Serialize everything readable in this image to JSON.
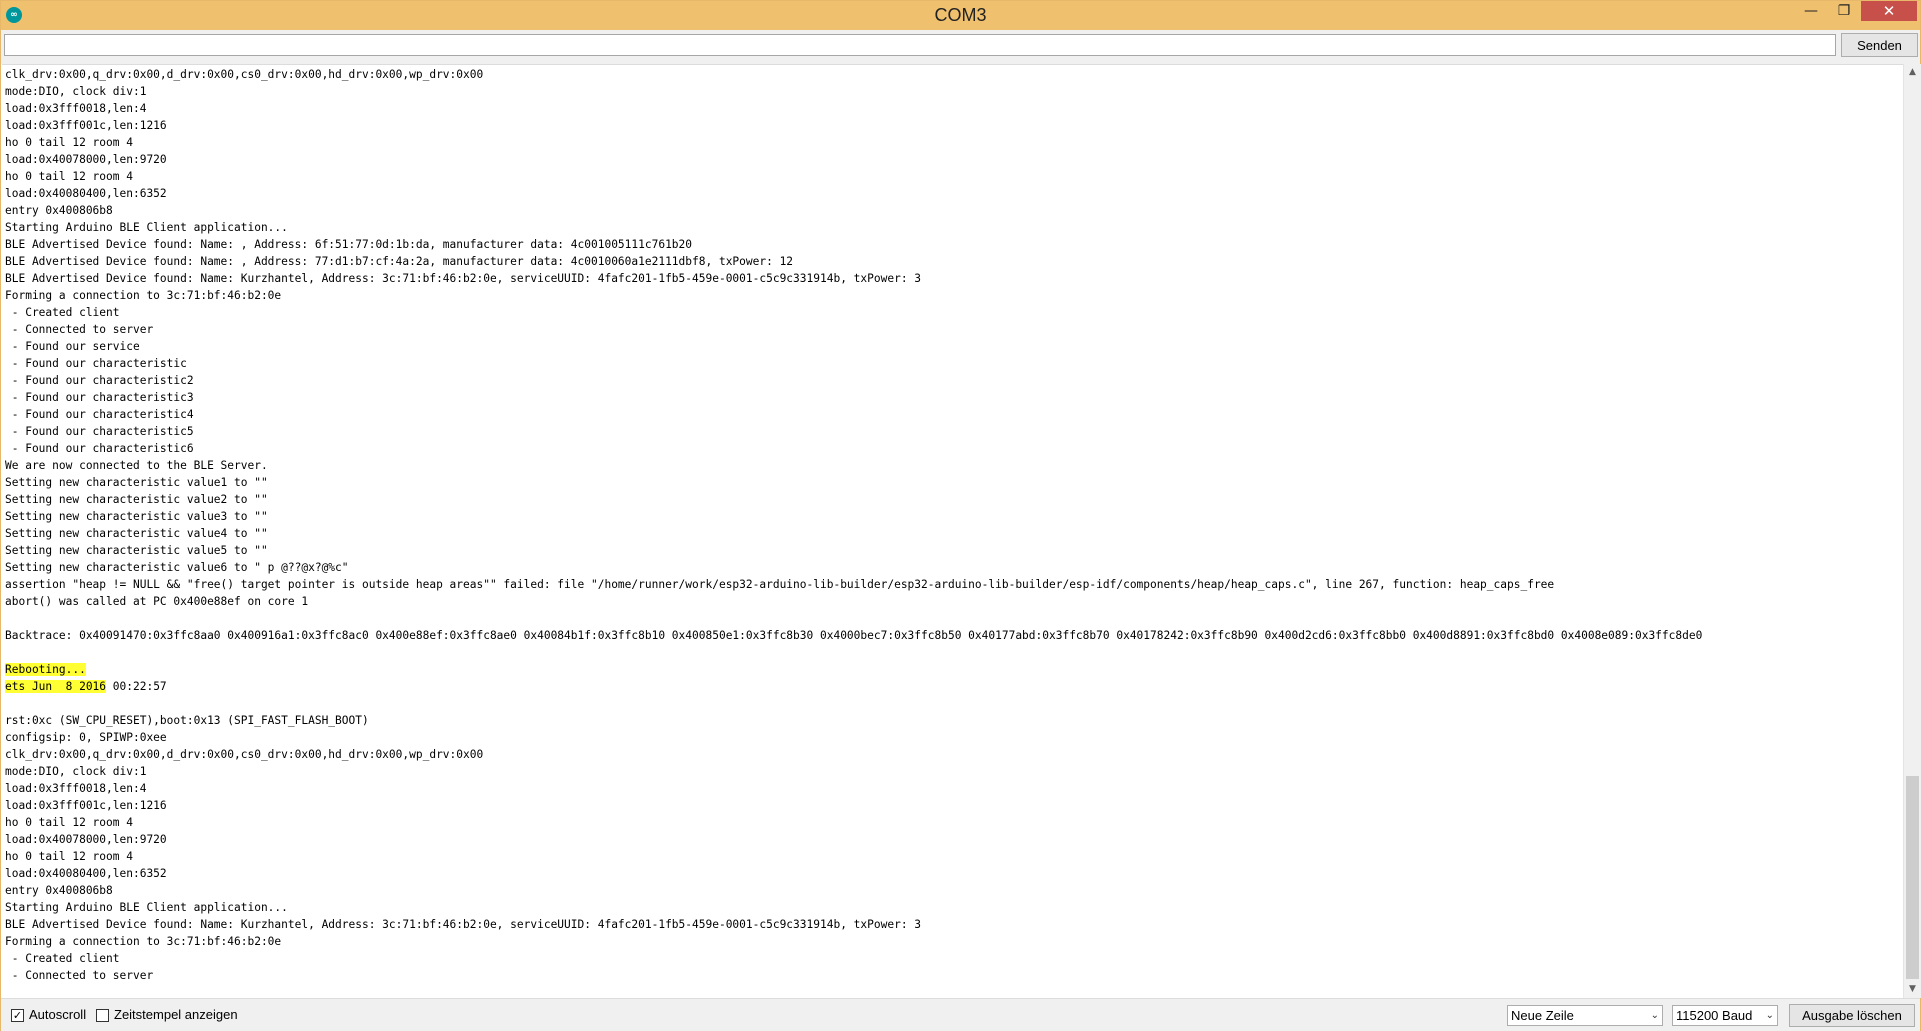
{
  "window": {
    "title": "COM3",
    "minimize_glyph": "—",
    "maximize_glyph": "❐",
    "close_glyph": "✕",
    "accent_color": "#efc06e",
    "close_color": "#c7504b"
  },
  "sendbar": {
    "input_value": "",
    "send_label": "Senden"
  },
  "output": {
    "lines": [
      {
        "text": "clk_drv:0x00,q_drv:0x00,d_drv:0x00,cs0_drv:0x00,hd_drv:0x00,wp_drv:0x00"
      },
      {
        "text": "mode:DIO, clock div:1"
      },
      {
        "text": "load:0x3fff0018,len:4"
      },
      {
        "text": "load:0x3fff001c,len:1216"
      },
      {
        "text": "ho 0 tail 12 room 4"
      },
      {
        "text": "load:0x40078000,len:9720"
      },
      {
        "text": "ho 0 tail 12 room 4"
      },
      {
        "text": "load:0x40080400,len:6352"
      },
      {
        "text": "entry 0x400806b8"
      },
      {
        "text": "Starting Arduino BLE Client application..."
      },
      {
        "text": "BLE Advertised Device found: Name: , Address: 6f:51:77:0d:1b:da, manufacturer data: 4c001005111c761b20"
      },
      {
        "text": "BLE Advertised Device found: Name: , Address: 77:d1:b7:cf:4a:2a, manufacturer data: 4c0010060a1e2111dbf8, txPower: 12"
      },
      {
        "text": "BLE Advertised Device found: Name: Kurzhantel, Address: 3c:71:bf:46:b2:0e, serviceUUID: 4fafc201-1fb5-459e-0001-c5c9c331914b, txPower: 3"
      },
      {
        "text": "Forming a connection to 3c:71:bf:46:b2:0e"
      },
      {
        "text": " - Created client"
      },
      {
        "text": " - Connected to server"
      },
      {
        "text": " - Found our service"
      },
      {
        "text": " - Found our characteristic"
      },
      {
        "text": " - Found our characteristic2"
      },
      {
        "text": " - Found our characteristic3"
      },
      {
        "text": " - Found our characteristic4"
      },
      {
        "text": " - Found our characteristic5"
      },
      {
        "text": " - Found our characteristic6"
      },
      {
        "text": "We are now connected to the BLE Server."
      },
      {
        "text": "Setting new characteristic value1 to \"\""
      },
      {
        "text": "Setting new characteristic value2 to \"\""
      },
      {
        "text": "Setting new characteristic value3 to \"\""
      },
      {
        "text": "Setting new characteristic value4 to \"\""
      },
      {
        "text": "Setting new characteristic value5 to \"\""
      },
      {
        "text": "Setting new characteristic value6 to \" p @??@x?@%c\""
      },
      {
        "text": "assertion \"heap != NULL && \"free() target pointer is outside heap areas\"\" failed: file \"/home/runner/work/esp32-arduino-lib-builder/esp32-arduino-lib-builder/esp-idf/components/heap/heap_caps.c\", line 267, function: heap_caps_free"
      },
      {
        "text": "abort() was called at PC 0x400e88ef on core 1"
      },
      {
        "text": ""
      },
      {
        "text": "Backtrace: 0x40091470:0x3ffc8aa0 0x400916a1:0x3ffc8ac0 0x400e88ef:0x3ffc8ae0 0x40084b1f:0x3ffc8b10 0x400850e1:0x3ffc8b30 0x4000bec7:0x3ffc8b50 0x40177abd:0x3ffc8b70 0x40178242:0x3ffc8b90 0x400d2cd6:0x3ffc8bb0 0x400d8891:0x3ffc8bd0 0x4008e089:0x3ffc8de0"
      },
      {
        "text": ""
      },
      {
        "text": "Rebooting...",
        "highlight": "Rebooting...",
        "rest": ""
      },
      {
        "text": "ets Jun  8 2016 00:22:57",
        "highlight": "ets Jun  8 2016",
        "rest": " 00:22:57"
      },
      {
        "text": ""
      },
      {
        "text": "rst:0xc (SW_CPU_RESET),boot:0x13 (SPI_FAST_FLASH_BOOT)"
      },
      {
        "text": "configsip: 0, SPIWP:0xee"
      },
      {
        "text": "clk_drv:0x00,q_drv:0x00,d_drv:0x00,cs0_drv:0x00,hd_drv:0x00,wp_drv:0x00"
      },
      {
        "text": "mode:DIO, clock div:1"
      },
      {
        "text": "load:0x3fff0018,len:4"
      },
      {
        "text": "load:0x3fff001c,len:1216"
      },
      {
        "text": "ho 0 tail 12 room 4"
      },
      {
        "text": "load:0x40078000,len:9720"
      },
      {
        "text": "ho 0 tail 12 room 4"
      },
      {
        "text": "load:0x40080400,len:6352"
      },
      {
        "text": "entry 0x400806b8"
      },
      {
        "text": "Starting Arduino BLE Client application..."
      },
      {
        "text": "BLE Advertised Device found: Name: Kurzhantel, Address: 3c:71:bf:46:b2:0e, serviceUUID: 4fafc201-1fb5-459e-0001-c5c9c331914b, txPower: 3"
      },
      {
        "text": "Forming a connection to 3c:71:bf:46:b2:0e"
      },
      {
        "text": " - Created client"
      },
      {
        "text": " - Connected to server"
      }
    ],
    "highlight_color": "#ffff33"
  },
  "scrollbar": {
    "up_glyph": "▲",
    "down_glyph": "▼"
  },
  "bottombar": {
    "autoscroll_label": "Autoscroll",
    "autoscroll_checked": true,
    "autoscroll_mark": "✓",
    "timestamp_label": "Zeitstempel anzeigen",
    "timestamp_checked": false,
    "line_ending": "Neue Zeile",
    "baud_rate": "115200 Baud",
    "dropdown_glyph": "⌄",
    "clear_label": "Ausgabe löschen"
  }
}
